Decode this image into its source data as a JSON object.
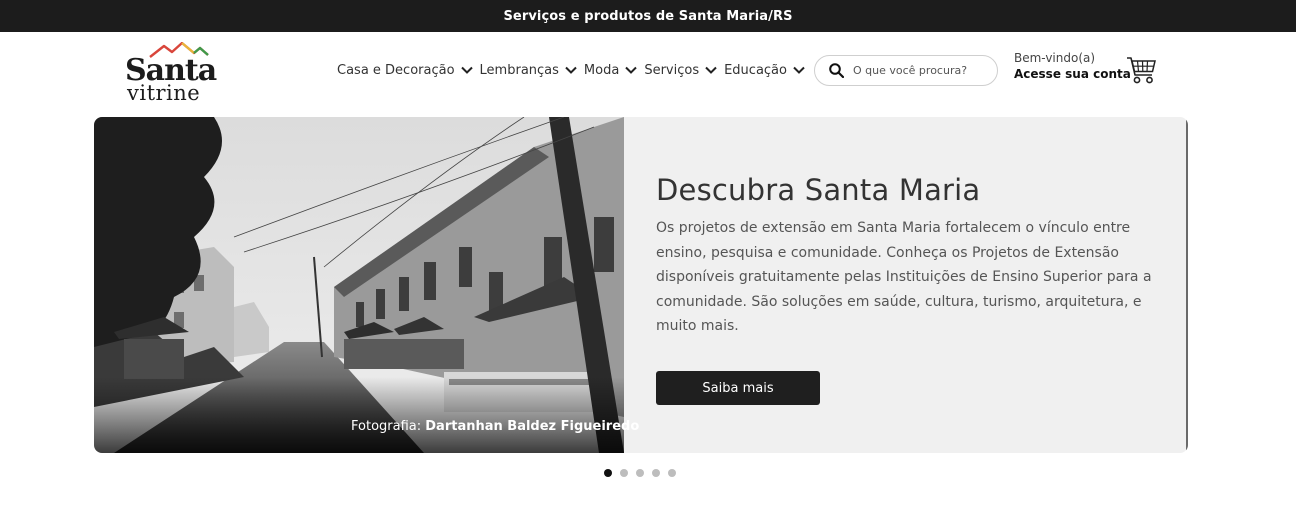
{
  "topbar": {
    "text": "Serviços e produtos de Santa Maria/RS"
  },
  "logo": {
    "line1": "Santa",
    "line2": "vitrine"
  },
  "nav": {
    "items": [
      {
        "label": "Casa e Decoração"
      },
      {
        "label": "Lembranças"
      },
      {
        "label": "Moda"
      },
      {
        "label": "Serviços"
      },
      {
        "label": "Educação"
      }
    ]
  },
  "search": {
    "placeholder": "O que você procura?",
    "value": ""
  },
  "account": {
    "greeting": "Bem-vindo(a)",
    "login_label": "Acesse sua conta"
  },
  "icons": {
    "search": "search-icon",
    "cart": "cart-icon",
    "chevron": "chevron-down-icon"
  },
  "hero": {
    "photo_credit_prefix": "Fotografia:",
    "photo_credit_author": "Dartanhan Baldez Figueiredo",
    "title": "Descubra Santa Maria",
    "text": "Os projetos de extensão em Santa Maria fortalecem o vínculo entre ensino, pesquisa e comunidade. Conheça os Projetos de Extensão disponíveis gratuitamente pelas Instituições de Ensino Superior para a comunidade. São soluções em saúde, cultura, turismo, arquitetura, e muito mais.",
    "button_label": "Saiba mais"
  },
  "carousel": {
    "slides": 5,
    "active": 1
  },
  "colors": {
    "dark": "#1c1c1c",
    "hero_bg": "#f0f0f0",
    "logo_red": "#d9453b",
    "logo_yellow": "#e9b43a",
    "logo_green": "#3f9a4a"
  }
}
